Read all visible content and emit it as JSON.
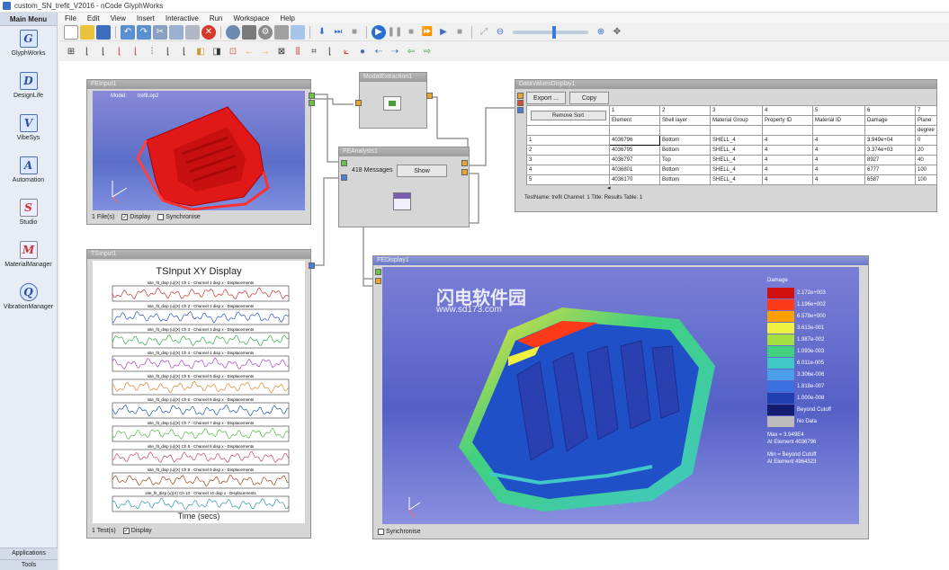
{
  "window": {
    "title": "custom_SN_trefit_V2016 - nCode GlyphWorks"
  },
  "menu": [
    "File",
    "Edit",
    "View",
    "Insert",
    "Interactive",
    "Run",
    "Workspace",
    "Help"
  ],
  "sidebar": {
    "header": "Main Menu",
    "items": [
      {
        "label": "GlyphWorks",
        "glyph": "G"
      },
      {
        "label": "DesignLife",
        "glyph": "D"
      },
      {
        "label": "VibeSys",
        "glyph": "V"
      },
      {
        "label": "Automation",
        "glyph": "A"
      },
      {
        "label": "Studio",
        "glyph": "S"
      },
      {
        "label": "MaterialManager",
        "glyph": "M"
      },
      {
        "label": "VibrationManager",
        "glyph": "Q"
      }
    ],
    "footer": [
      "Applications",
      "Tools"
    ]
  },
  "fe_input": {
    "title": "FEInput1",
    "model_label": "Model:",
    "model_value": "trefit.op2",
    "files": "1 File(s)",
    "display": "Display",
    "synchronise": "Synchronise"
  },
  "xy_input": {
    "title": "TSInput1",
    "chart_title": "TSInput XY Display",
    "xlabel": "Time (secs)",
    "tests": "1 Test(s)",
    "display": "Display"
  },
  "chart_data": {
    "type": "line",
    "title": "TSInput XY Display",
    "xlabel": "Time (secs)",
    "series": [
      {
        "name": "site_fit_disp (u)(X) Ch 1 - Channel 1 disp x - Displacements",
        "color": "#cc3333"
      },
      {
        "name": "site_fit_disp (u)(X) Ch 2 - Channel 2 disp x - Displacements",
        "color": "#3355cc"
      },
      {
        "name": "site_fit_disp (u)(X) Ch 3 - Channel 3 disp x - Displacements",
        "color": "#33aa55"
      },
      {
        "name": "site_fit_disp (u)(X) Ch 4 - Channel 4 disp x - Displacements",
        "color": "#aa44cc"
      },
      {
        "name": "site_fit_disp (u)(X) Ch 5 - Channel 5 disp x - Displacements",
        "color": "#dd8833"
      },
      {
        "name": "site_fit_disp (u)(X) Ch 6 - Channel 6 disp x - Displacements",
        "color": "#2255aa"
      },
      {
        "name": "site_fit_disp (u)(X) Ch 7 - Channel 7 disp x - Displacements",
        "color": "#55bb44"
      },
      {
        "name": "site_fit_disp (u)(X) Ch 8 - Channel 8 disp x - Displacements",
        "color": "#cc4477"
      },
      {
        "name": "site_fit_disp (u)(X) Ch 9 - Channel 9 disp x - Displacements",
        "color": "#994422"
      },
      {
        "name": "site_fit_disp (u)(X) Ch 10 - Channel 10 disp x - Displacements",
        "color": "#3399aa"
      }
    ]
  },
  "modal_detection": {
    "title": "ModalExtraction1"
  },
  "fe_analysis": {
    "title": "FEAnalysis1",
    "messages": "418 Messages",
    "show": "Show"
  },
  "data_values": {
    "title": "DataValuesDisplay1",
    "export": "Export ...",
    "copy": "Copy",
    "remove_sort": "Remove Sort",
    "col_numbers": [
      "1",
      "2",
      "3",
      "4",
      "5",
      "6",
      "7"
    ],
    "columns": [
      "Element",
      "Shell layer",
      "Material Group",
      "Property ID",
      "Material ID",
      "Damage",
      "Plane"
    ],
    "unit_row": [
      "",
      "",
      "",
      "",
      "",
      "",
      "degree"
    ],
    "rows": [
      {
        "idx": "1",
        "cells": [
          "4036796",
          "Bottom",
          "SHELL_4",
          "4",
          "4",
          "3.949e+04",
          "0"
        ]
      },
      {
        "idx": "2",
        "cells": [
          "4036795",
          "Bottom",
          "SHELL_4",
          "4",
          "4",
          "3.374e+03",
          "20"
        ]
      },
      {
        "idx": "3",
        "cells": [
          "4036797",
          "Top",
          "SHELL_4",
          "4",
          "4",
          "8927",
          "40"
        ]
      },
      {
        "idx": "4",
        "cells": [
          "4036801",
          "Bottom",
          "SHELL_4",
          "4",
          "4",
          "6777",
          "100"
        ]
      },
      {
        "idx": "5",
        "cells": [
          "4036170",
          "Bottom",
          "SHELL_4",
          "4",
          "4",
          "6587",
          "100"
        ]
      }
    ],
    "status": "TestName: trefit  Channel: 1  Title: Results  Table: 1"
  },
  "fe_display": {
    "title": "FEDisplay1",
    "synchronise": "Synchronise",
    "legend_title": "Damage",
    "legend": [
      {
        "label": "2.172e+003",
        "color": "#d21010"
      },
      {
        "label": "1.196e+002",
        "color": "#ff3a1a"
      },
      {
        "label": "6.578e+000",
        "color": "#ffa000"
      },
      {
        "label": "3.613e-001",
        "color": "#f0f040"
      },
      {
        "label": "1.987e-002",
        "color": "#a6e040"
      },
      {
        "label": "1.093e-003",
        "color": "#40d080"
      },
      {
        "label": "6.011e-005",
        "color": "#40c8c8"
      },
      {
        "label": "3.306e-006",
        "color": "#4aa0ea"
      },
      {
        "label": "1.818e-007",
        "color": "#3a70e0"
      },
      {
        "label": "1.000e-008",
        "color": "#2040b0"
      },
      {
        "label": "Beyond Cutoff",
        "color": "#151d70"
      },
      {
        "label": "No Data",
        "color": "#bbbbbb"
      }
    ],
    "max_label": "Max = 3.949E4",
    "max_elem": "At Element 4036796",
    "min_label": "Min = Beyond Cutoff",
    "min_elem": "At Element 4964323"
  },
  "watermark": {
    "cn": "闪电软件园",
    "url": "www.sd173.com"
  }
}
